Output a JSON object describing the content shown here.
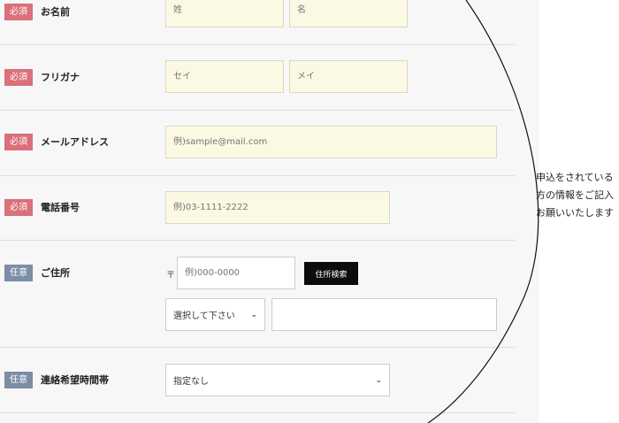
{
  "form": {
    "rows": [
      {
        "badge": "必須",
        "label": "お名前",
        "placeholders": [
          "姓",
          "名"
        ]
      },
      {
        "badge": "必須",
        "label": "フリガナ",
        "placeholders": [
          "セイ",
          "メイ"
        ]
      },
      {
        "badge": "必須",
        "label": "メールアドレス",
        "placeholder": "例)sample@mail.com"
      },
      {
        "badge": "必須",
        "label": "電話番号",
        "placeholder": "例)03-1111-2222"
      },
      {
        "badge": "任意",
        "label": "ご住所",
        "zip_mark": "〒",
        "zip_placeholder": "例)000-0000",
        "search_button": "住所検索",
        "prefecture_select": "選択して下さい",
        "address_value": ""
      },
      {
        "badge": "任意",
        "label": "連絡希望時間帯",
        "select_value": "指定なし"
      }
    ]
  },
  "side_note": {
    "lines": [
      "申込をされている",
      "方の情報をご記入",
      "お願いいたします"
    ]
  },
  "colors": {
    "required_badge": "#d9707a",
    "optional_badge": "#7c8ea5",
    "input_bg": "#fbf9e3",
    "button_bg": "#0c0c0c"
  }
}
